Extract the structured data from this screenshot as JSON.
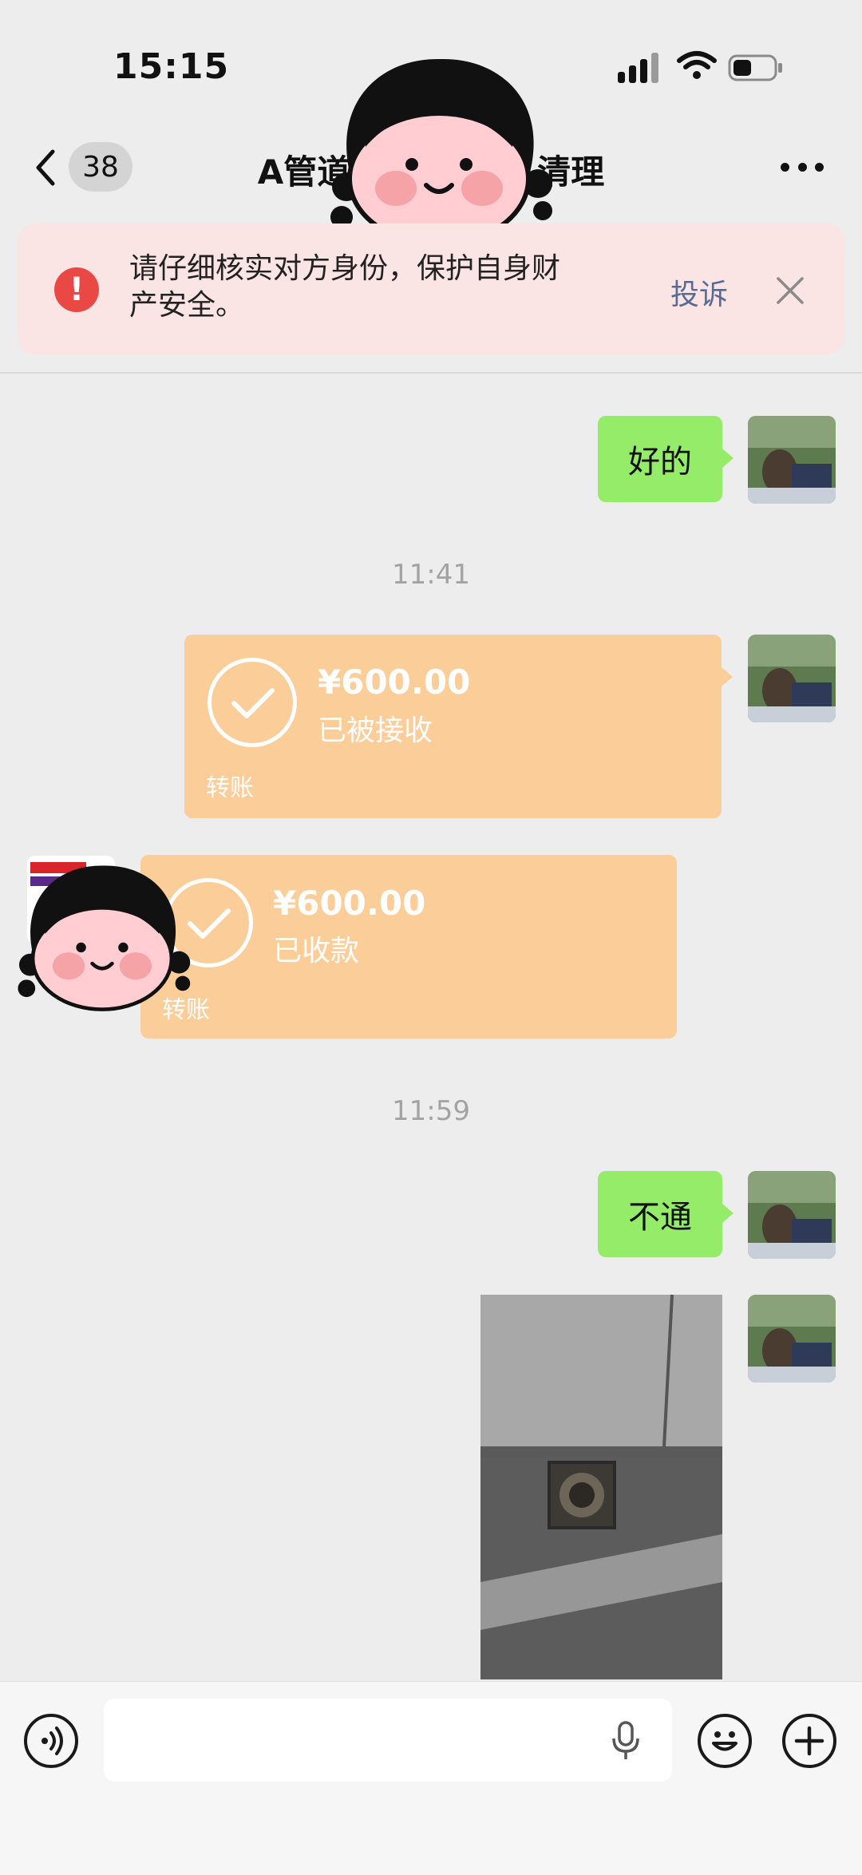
{
  "status_bar": {
    "time": "15:15"
  },
  "nav": {
    "unread_count": "38",
    "title": "A管道                清理"
  },
  "banner": {
    "message": "请仔细核实对方身份，保护自身财产安全。",
    "complain_label": "投诉"
  },
  "messages": [
    {
      "type": "text",
      "side": "right",
      "text": "好的"
    },
    {
      "type": "timestamp",
      "text": "11:41"
    },
    {
      "type": "transfer",
      "side": "right",
      "amount": "¥600.00",
      "status": "已被接收",
      "label": "转账"
    },
    {
      "type": "transfer",
      "side": "left",
      "amount": "¥600.00",
      "status": "已收款",
      "label": "转账"
    },
    {
      "type": "timestamp",
      "text": "11:59"
    },
    {
      "type": "text",
      "side": "right",
      "text": "不通"
    },
    {
      "type": "image",
      "side": "right"
    }
  ],
  "input_bar": {
    "value": ""
  },
  "colors": {
    "green_bubble": "#95ec69",
    "transfer_bubble": "#fbcd99",
    "warning_red": "#e94845",
    "link_blue": "#576b95"
  },
  "icons": [
    "back-chevron-icon",
    "more-icon",
    "warning-icon",
    "close-icon",
    "voice-icon",
    "microphone-icon",
    "emoji-icon",
    "plus-icon",
    "cellular-signal-icon",
    "wifi-icon",
    "battery-icon"
  ]
}
